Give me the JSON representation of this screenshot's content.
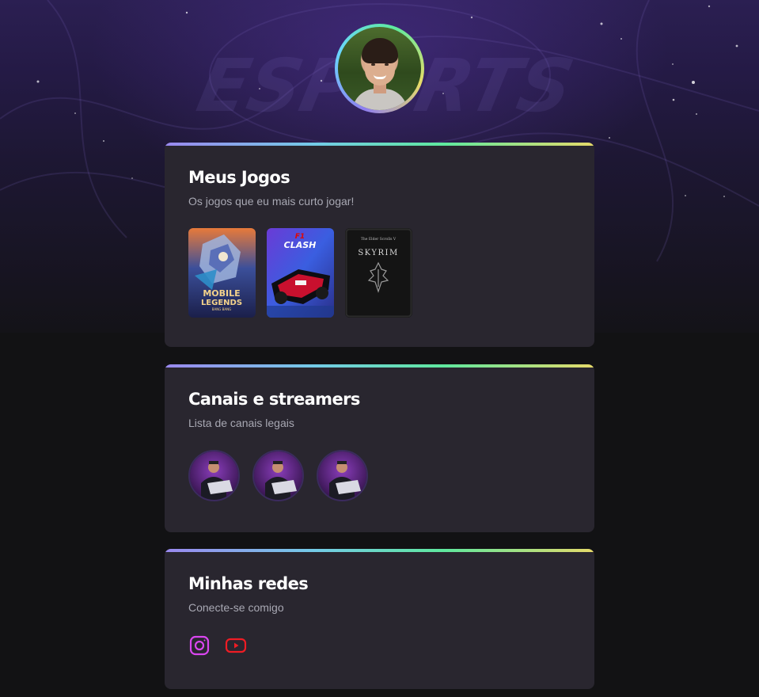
{
  "profile": {
    "avatar_icon": "profile-photo"
  },
  "games_card": {
    "title": "Meus Jogos",
    "subtitle": "Os jogos que eu mais curto jogar!",
    "games": [
      {
        "name": "Mobile Legends",
        "logo_line1": "MOBILE",
        "logo_line2": "LEGENDS",
        "logo_line3": "BANG BANG"
      },
      {
        "name": "F1 Clash",
        "logo_line1": "F1",
        "logo_line2": "CLASH"
      },
      {
        "name": "Skyrim",
        "logo_line1": "The Elder Scrolls V",
        "logo_line2": "SKYRIM"
      }
    ]
  },
  "channels_card": {
    "title": "Canais e streamers",
    "subtitle": "Lista de canais legais",
    "channels": [
      {
        "icon": "streamer-avatar"
      },
      {
        "icon": "streamer-avatar"
      },
      {
        "icon": "streamer-avatar"
      }
    ]
  },
  "social_card": {
    "title": "Minhas redes",
    "subtitle": "Conecte-se comigo",
    "links": [
      {
        "icon": "instagram-icon",
        "color": "#d946ef"
      },
      {
        "icon": "youtube-icon",
        "color": "#ef1c24"
      }
    ]
  },
  "colors": {
    "background": "#121214",
    "card": "#29262f",
    "text_secondary": "#a8a8b3",
    "gradient": [
      "#9a88ef",
      "#73cbe7",
      "#5fe89e",
      "#e6da6a"
    ]
  }
}
